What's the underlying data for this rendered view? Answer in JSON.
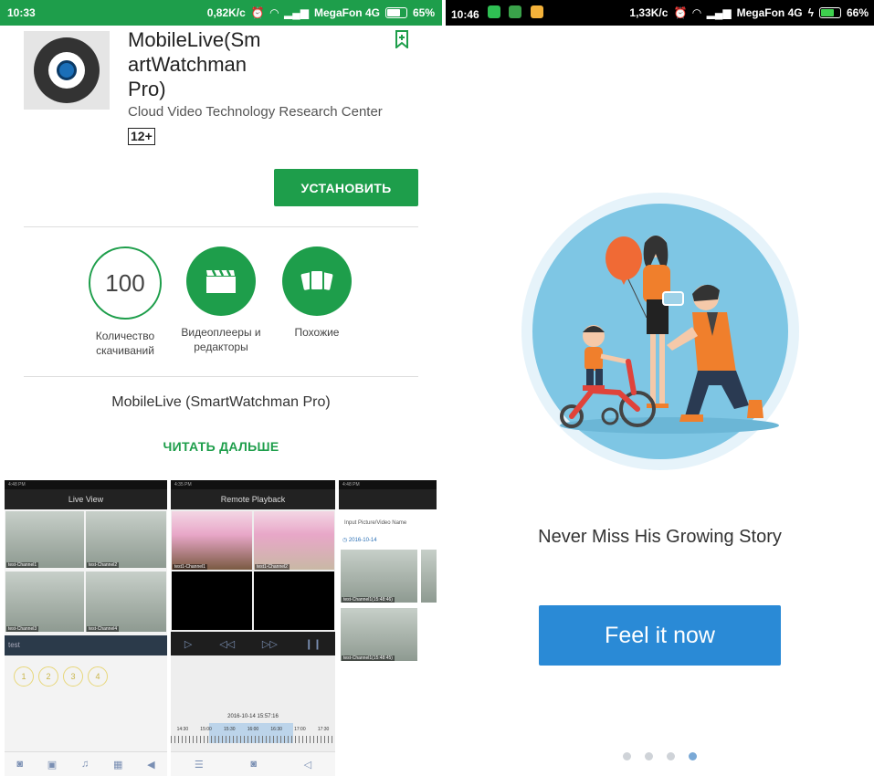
{
  "left": {
    "status": {
      "time": "10:33",
      "speed": "0,82K/c",
      "carrier": "MegaFon 4G",
      "battery": "65%"
    },
    "app": {
      "title_lines": [
        "MobileLive(Sm",
        "artWatchman",
        "Pro)"
      ],
      "developer": "Cloud Video Technology Research Center",
      "age_rating": "12+",
      "install_label": "УСТАНОВИТЬ"
    },
    "stats": [
      {
        "value": "100",
        "label_lines": [
          "Количество",
          "скачиваний"
        ],
        "icon": "downloads-circle"
      },
      {
        "value": "",
        "label_lines": [
          "Видеоплееры и",
          "редакторы"
        ],
        "icon": "clapperboard-icon"
      },
      {
        "value": "",
        "label_lines": [
          "Похожие"
        ],
        "icon": "similar-cards-icon"
      }
    ],
    "description": "MobileLive (SmartWatchman Pro)",
    "read_more": "ЧИТАТЬ ДАЛЬШЕ",
    "screenshots": {
      "s1": {
        "title": "Live View",
        "cams": [
          "test-Channel1",
          "test-Channel2",
          "test-Channel3",
          "test-Channel4"
        ],
        "device": "test",
        "buttons": [
          "1",
          "2",
          "3",
          "4"
        ]
      },
      "s2": {
        "title": "Remote Playback",
        "cams": [
          "test1-Channel1",
          "test1-Channel2"
        ],
        "datetime": "2016-10-14  15:57:16",
        "ticks": [
          "14:30",
          "15:00",
          "15:30",
          "16:00",
          "16:30",
          "17:00",
          "17:30"
        ]
      },
      "s3": {
        "input_label": "Input Picture/Video Name",
        "date": "2016-10-14",
        "items": [
          "test-Channel1(15:48:46)",
          "test-Channel1(15:48:45)"
        ]
      }
    }
  },
  "right": {
    "status": {
      "time": "10:46",
      "speed": "1,33K/c",
      "carrier": "MegaFon 4G",
      "battery": "66%"
    },
    "tagline": "Never Miss His Growing Story",
    "cta": "Feel it now",
    "page_dots": 4,
    "active_dot": 3
  },
  "colors": {
    "play_green": "#1e9e4b",
    "cta_blue": "#2a8ad6",
    "illus_sky": "#7ec6e4"
  }
}
